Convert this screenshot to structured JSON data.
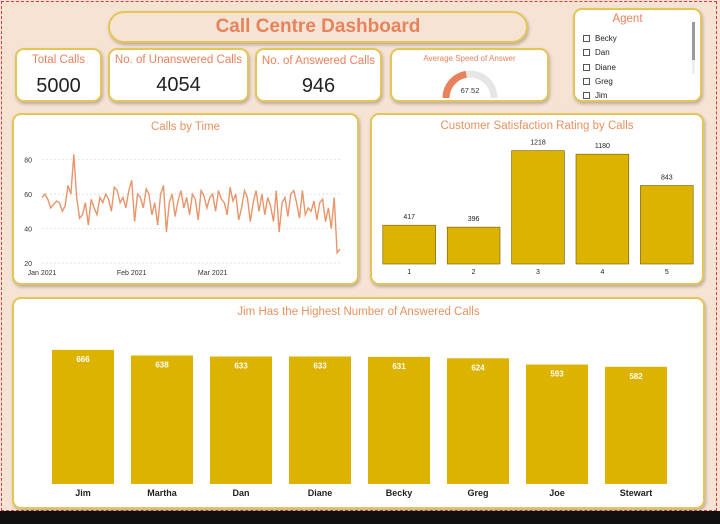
{
  "header": {
    "title": "Call Centre Dashboard"
  },
  "kpis": [
    {
      "label": "Total Calls",
      "value": "5000"
    },
    {
      "label": "No. of Unanswered Calls",
      "value": "4054"
    },
    {
      "label": "No. of Answered Calls",
      "value": "946"
    }
  ],
  "gauge": {
    "label": "Average Speed of Answer",
    "value": "67.52",
    "fraction": 0.45
  },
  "agent_filter": {
    "title": "Agent",
    "items": [
      "Becky",
      "Dan",
      "Diane",
      "Greg",
      "Jim"
    ]
  },
  "colors": {
    "accent": "#e8825b",
    "bar": "#dbb300",
    "line": "#e8956a",
    "border": "#e3c657"
  },
  "chart_data": [
    {
      "type": "line",
      "title": "Calls by Time",
      "x_ticks": [
        "Jan 2021",
        "Feb 2021",
        "Mar 2021"
      ],
      "x_start": "2021-01-01",
      "y_ticks": [
        20,
        40,
        60,
        80
      ],
      "ylim": [
        20,
        85
      ],
      "grid": true,
      "values": [
        58,
        60,
        57,
        52,
        54,
        56,
        55,
        50,
        53,
        65,
        60,
        83,
        58,
        46,
        48,
        55,
        42,
        57,
        52,
        48,
        58,
        55,
        60,
        57,
        50,
        64,
        62,
        55,
        58,
        52,
        62,
        68,
        44,
        60,
        58,
        52,
        63,
        60,
        48,
        55,
        42,
        60,
        65,
        38,
        55,
        60,
        47,
        56,
        62,
        52,
        58,
        48,
        60,
        57,
        45,
        62,
        59,
        52,
        58,
        60,
        50,
        62,
        57,
        55,
        48,
        64,
        56,
        60,
        45,
        52,
        62,
        58,
        44,
        55,
        62,
        50,
        60,
        48,
        58,
        53,
        44,
        62,
        38,
        55,
        58,
        47,
        60,
        62,
        55,
        46,
        62,
        48,
        52,
        50,
        56,
        45,
        55,
        57,
        44,
        52,
        40,
        58,
        26,
        28
      ]
    },
    {
      "type": "bar",
      "title": "Customer Satisfaction Rating by Calls",
      "categories": [
        "1",
        "2",
        "3",
        "4",
        "5"
      ],
      "values": [
        417,
        396,
        1218,
        1180,
        843
      ],
      "ylim": [
        0,
        1300
      ]
    },
    {
      "type": "bar",
      "title": "Jim Has the Highest Number of Answered Calls",
      "categories": [
        "Jim",
        "Martha",
        "Dan",
        "Diane",
        "Becky",
        "Greg",
        "Joe",
        "Stewart"
      ],
      "values": [
        666,
        638,
        633,
        633,
        631,
        624,
        593,
        582
      ],
      "ylim": [
        0,
        700
      ]
    }
  ]
}
